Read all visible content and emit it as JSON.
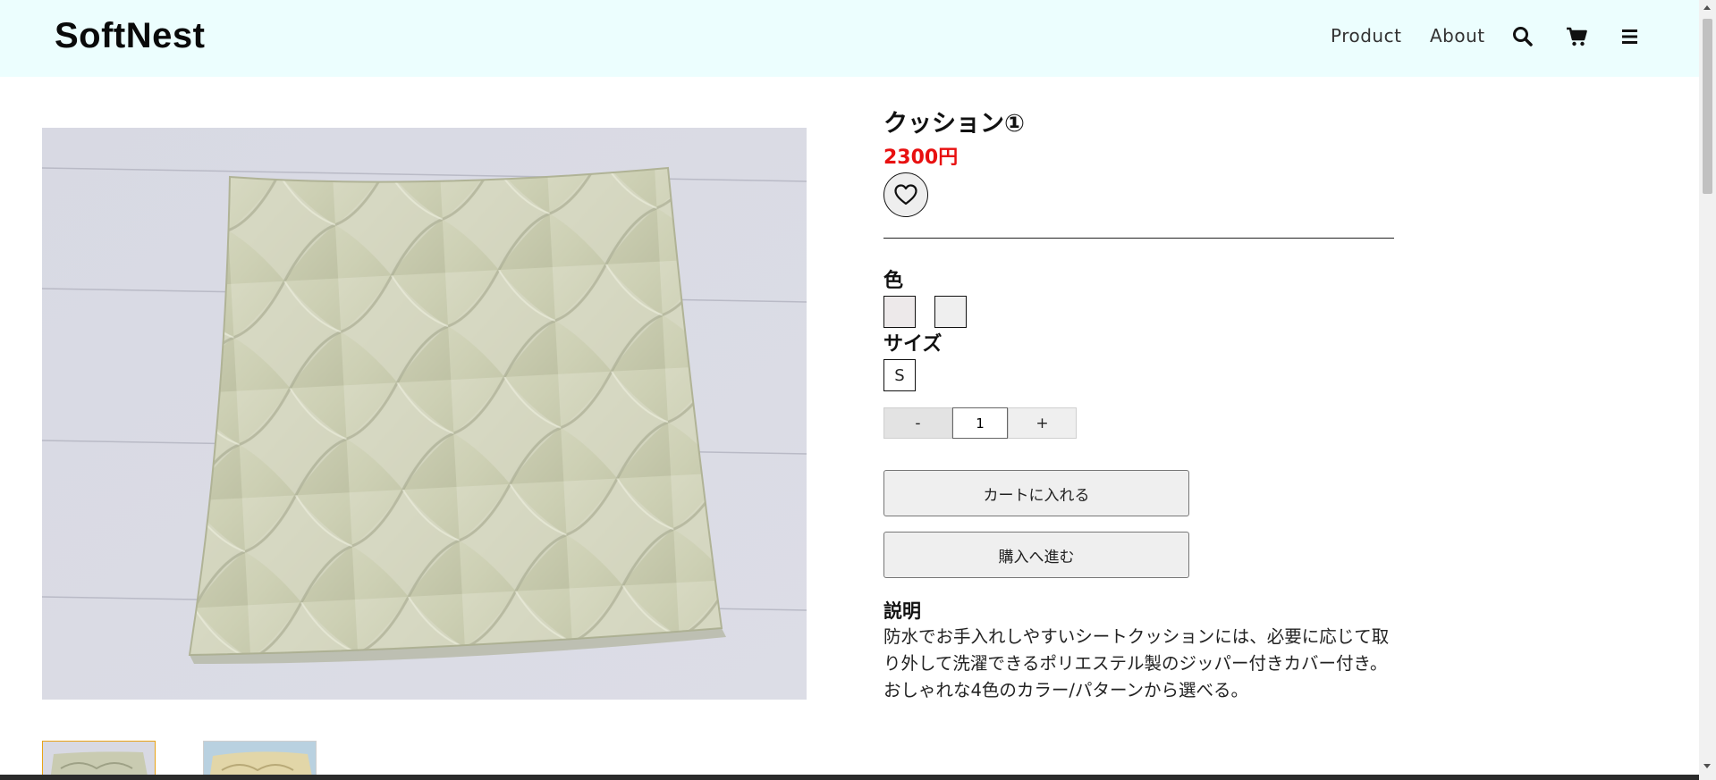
{
  "header": {
    "logo": "SoftNest",
    "nav": [
      {
        "label": "Product"
      },
      {
        "label": "About"
      }
    ],
    "icons": [
      "search-icon",
      "cart-icon",
      "menu-icon"
    ]
  },
  "product": {
    "title": "クッション①",
    "price": "2300円",
    "favorite_icon": "heart-icon",
    "color_label": "色",
    "colors": [
      "#ede9ea",
      "#efefef"
    ],
    "size_label": "サイズ",
    "sizes": [
      "S"
    ],
    "quantity": {
      "minus": "-",
      "value": "1",
      "plus": "+"
    },
    "add_to_cart": "カートに入れる",
    "proceed_to_purchase": "購入へ進む",
    "description_label": "説明",
    "description": "防水でお手入れしやすいシートクッションには、必要に応じて取り外して洗濯できるポリエステル製のジッパー付きカバー付き。おしゃれな4色のカラー/パターンから選べる。"
  },
  "colors": {
    "header_bg": "#ecfefe",
    "price": "#e81010",
    "selected_thumb_border": "#e8a317"
  }
}
